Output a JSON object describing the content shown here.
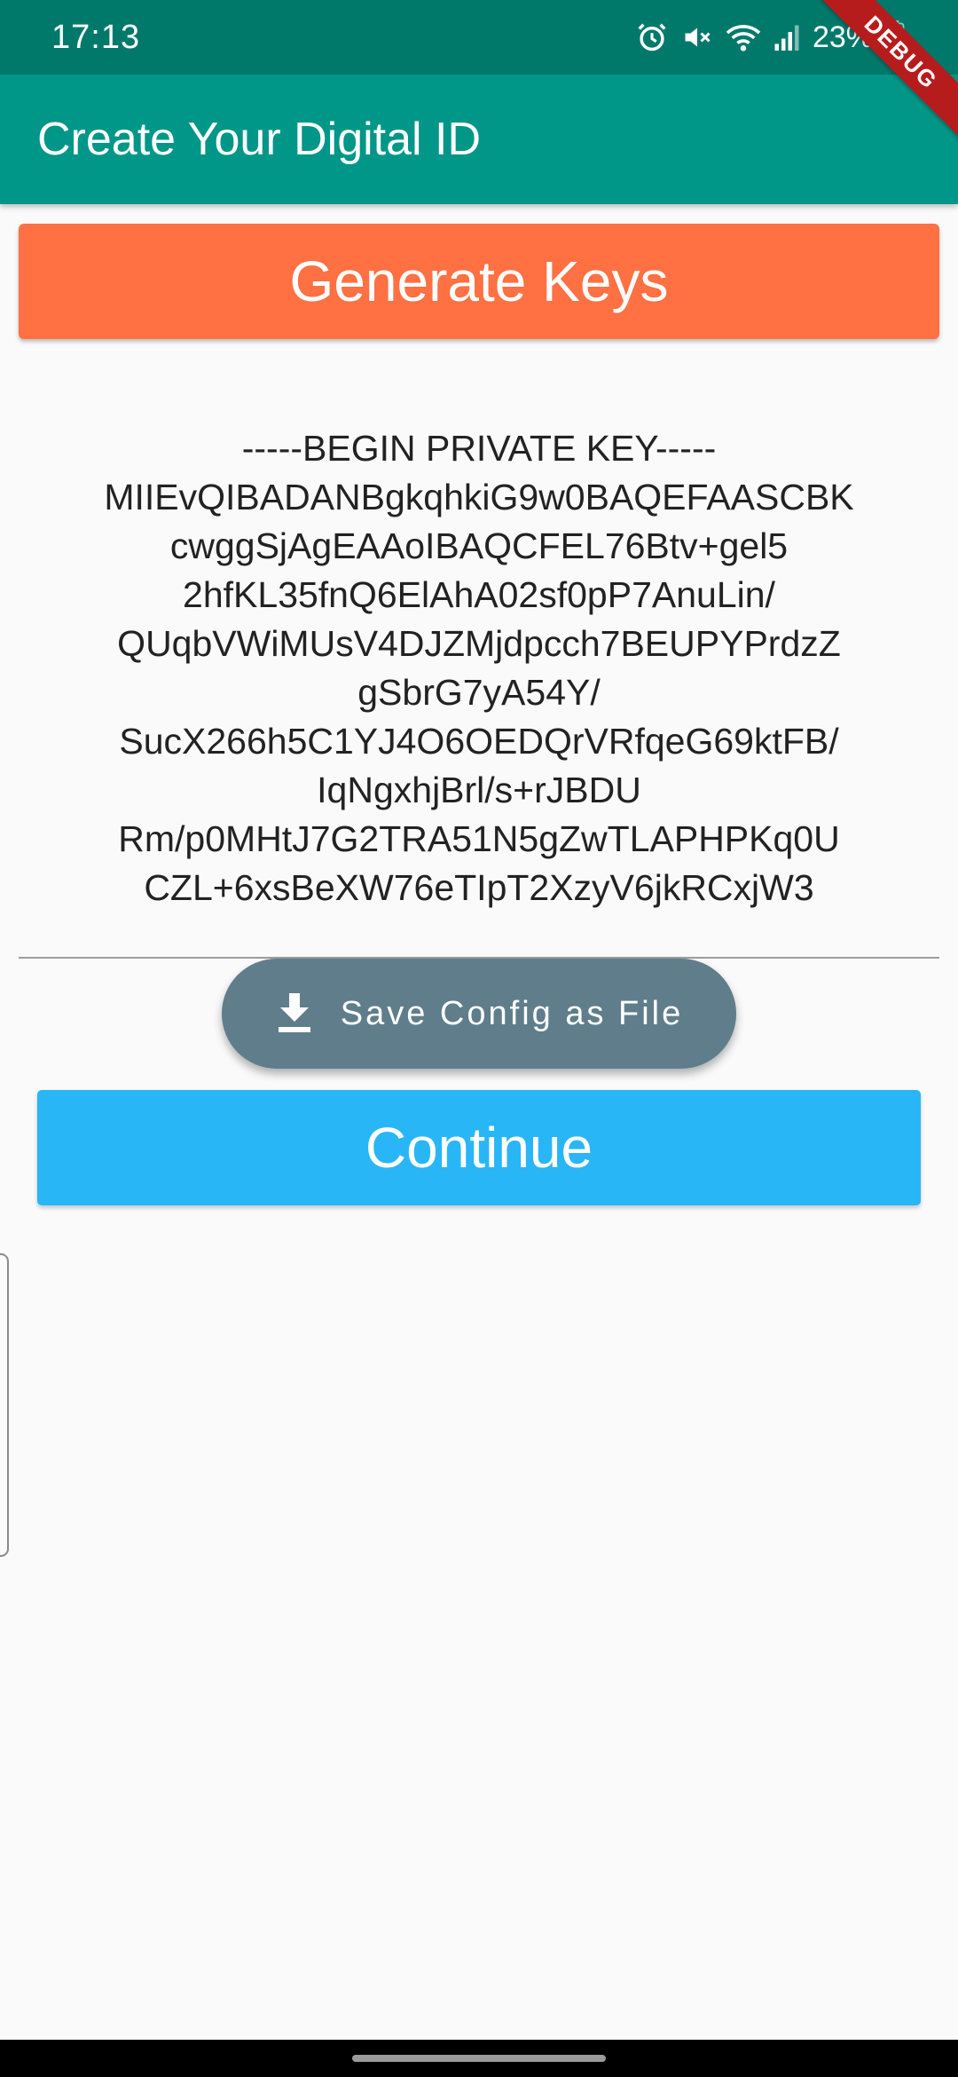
{
  "status_bar": {
    "time": "17:13",
    "battery": "23%",
    "icons": [
      "alarm-icon",
      "mute-icon",
      "wifi-icon",
      "signal-icon",
      "battery-icon"
    ]
  },
  "debug_banner": "DEBUG",
  "app_bar": {
    "title": "Create Your Digital ID"
  },
  "buttons": {
    "generate_keys": "Generate Keys",
    "save_config": "Save Config as File",
    "continue": "Continue"
  },
  "private_key": {
    "lines": [
      "-----BEGIN PRIVATE KEY-----",
      "MIIEvQIBADANBgkqhkiG9w0BAQEFAASCBK",
      "cwggSjAgEAAoIBAQCFEL76Btv+gel5",
      "2hfKL35fnQ6ElAhA02sf0pP7AnuLin/",
      "QUqbVWiMUsV4DJZMjdpcch7BEUPYPrdzZ",
      "gSbrG7yA54Y/",
      "SucX266h5C1YJ4O6OEDQrVRfqeG69ktFB/",
      "IqNgxhjBrl/s+rJBDU",
      "Rm/p0MHtJ7G2TRA51N5gZwTLAPHPKq0U",
      "CZL+6xsBeXW76eTIpT2XzyV6jkRCxjW3"
    ]
  },
  "colors": {
    "status_bar": "#00796b",
    "app_bar": "#009688",
    "generate_button": "#ff7043",
    "save_button": "#607d8b",
    "continue_button": "#29b6f6",
    "background": "#fafafa"
  }
}
